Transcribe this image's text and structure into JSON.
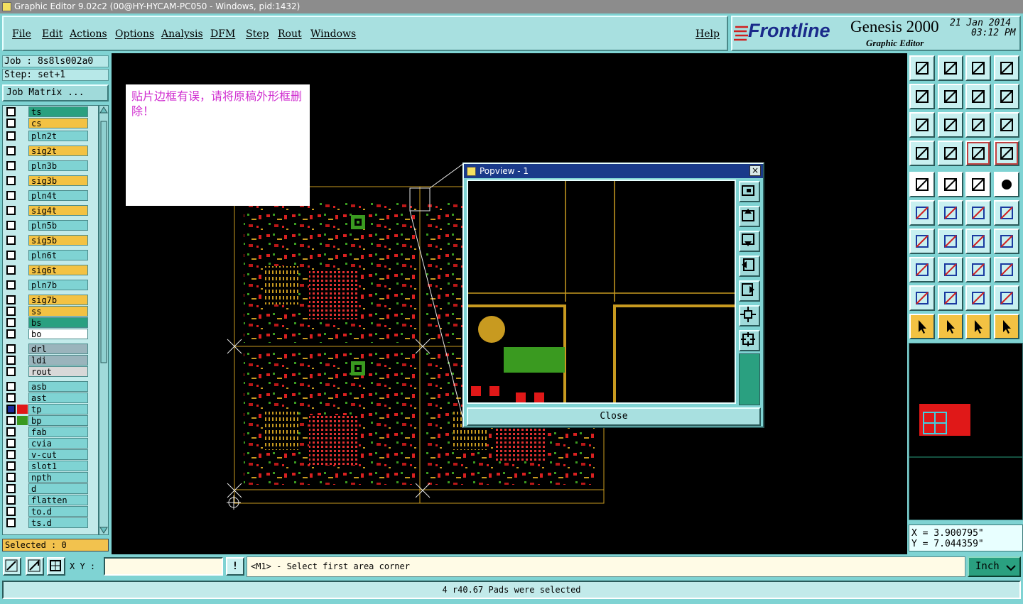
{
  "window": {
    "title": "Graphic Editor 9.02c2 (00@HY-HYCAM-PC050 - Windows, pid:1432)"
  },
  "menu": {
    "items": [
      "File",
      "Edit",
      "Actions",
      "Options",
      "Analysis",
      "DFM",
      "Step",
      "Rout",
      "Windows"
    ],
    "help": "Help"
  },
  "brand": {
    "logo": "Frontline",
    "product": "Genesis 2000",
    "subtitle": "Graphic Editor",
    "date": "21 Jan 2014",
    "time": "03:12 PM"
  },
  "job": {
    "job_line": "Job : 8s8ls002a0",
    "step_line": "Step: set+1",
    "matrix_button": "Job Matrix ..."
  },
  "layers": [
    {
      "name": "ts",
      "color": "#2aa080"
    },
    {
      "name": "cs",
      "color": "#f3c243"
    },
    {
      "name": "pln2t",
      "color": "#7fd3d3"
    },
    {
      "name": "sig2t",
      "color": "#f3c243"
    },
    {
      "name": "pln3b",
      "color": "#7fd3d3"
    },
    {
      "name": "sig3b",
      "color": "#f3c243"
    },
    {
      "name": "pln4t",
      "color": "#7fd3d3"
    },
    {
      "name": "sig4t",
      "color": "#f3c243"
    },
    {
      "name": "pln5b",
      "color": "#7fd3d3"
    },
    {
      "name": "sig5b",
      "color": "#f3c243"
    },
    {
      "name": "pln6t",
      "color": "#7fd3d3"
    },
    {
      "name": "sig6t",
      "color": "#f3c243"
    },
    {
      "name": "pln7b",
      "color": "#7fd3d3"
    },
    {
      "name": "sig7b",
      "color": "#f3c243"
    },
    {
      "name": "ss",
      "color": "#f3c243"
    },
    {
      "name": "bs",
      "color": "#2aa080"
    },
    {
      "name": "bo",
      "color": "#ffffff"
    },
    {
      "name": "drl",
      "color": "#9ab4bc"
    },
    {
      "name": "ldi",
      "color": "#9ab4bc"
    },
    {
      "name": "rout",
      "color": "#d8d8d8"
    },
    {
      "name": "asb",
      "color": "#7fd3d3"
    },
    {
      "name": "ast",
      "color": "#7fd3d3"
    },
    {
      "name": "tp",
      "color": "#7fd3d3"
    },
    {
      "name": "bp",
      "color": "#7fd3d3"
    },
    {
      "name": "fab",
      "color": "#7fd3d3"
    },
    {
      "name": "cvia",
      "color": "#7fd3d3"
    },
    {
      "name": "v-cut",
      "color": "#7fd3d3"
    },
    {
      "name": "slot1",
      "color": "#7fd3d3"
    },
    {
      "name": "npth",
      "color": "#7fd3d3"
    },
    {
      "name": "d",
      "color": "#7fd3d3"
    },
    {
      "name": "flatten",
      "color": "#7fd3d3"
    },
    {
      "name": "to.d",
      "color": "#7fd3d3"
    },
    {
      "name": "ts.d",
      "color": "#7fd3d3"
    }
  ],
  "selected_count": "Selected : 0",
  "note": {
    "text": "贴片边框有误，请将原稿外形框删除！"
  },
  "popview": {
    "title": "Popview - 1",
    "close_x": "×",
    "close_button": "Close"
  },
  "coords": {
    "x": "X = 3.900795\"",
    "y": "Y = 7.044359\""
  },
  "bottom": {
    "xy_label": "X Y :",
    "xy_value": "",
    "alert_glyph": "!",
    "prompt": "<M1> - Select first area corner",
    "unit": "Inch",
    "status": "4 r40.67 Pads were selected"
  }
}
